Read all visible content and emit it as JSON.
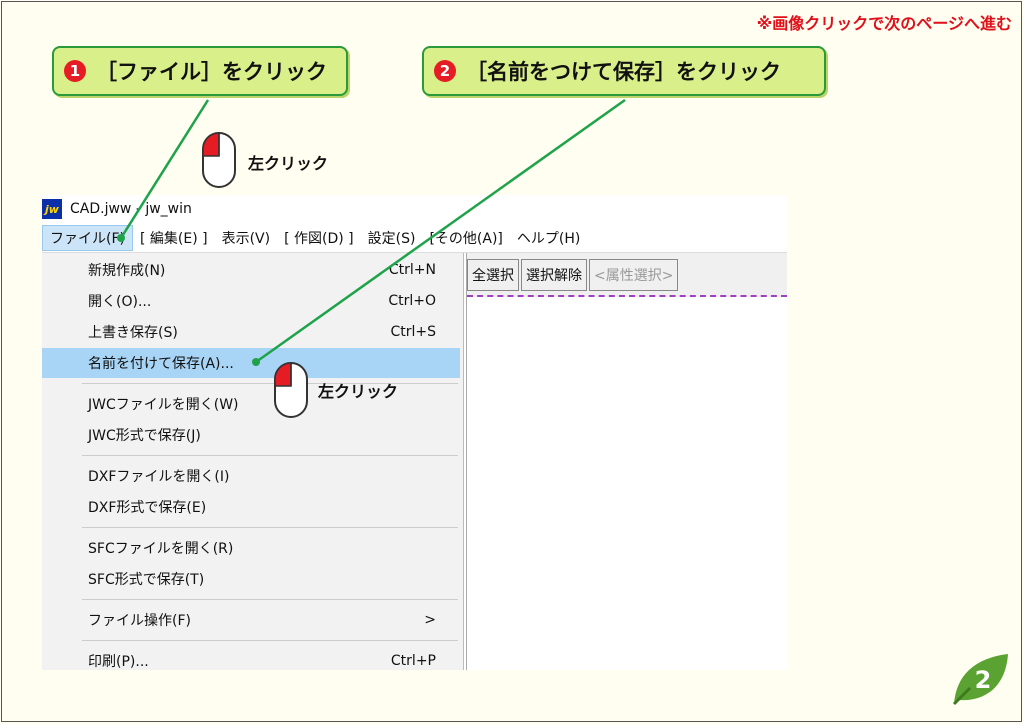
{
  "hint": "※画像クリックで次のページへ進む",
  "callouts": [
    {
      "num": "1",
      "text": "［ファイル］をクリック"
    },
    {
      "num": "2",
      "text": "［名前をつけて保存］をクリック"
    }
  ],
  "mouse_label": "左クリック",
  "window": {
    "logo": "jw",
    "title": "CAD.jww - jw_win"
  },
  "menubar": [
    "ファイル(F)",
    "[ 編集(E) ]",
    "表示(V)",
    "[ 作図(D) ]",
    "設定(S)",
    "[その他(A)]",
    "ヘルプ(H)"
  ],
  "file_menu": [
    {
      "label": "新規作成(N)",
      "shortcut": "Ctrl+N"
    },
    {
      "label": "開く(O)...",
      "shortcut": "Ctrl+O"
    },
    {
      "label": "上書き保存(S)",
      "shortcut": "Ctrl+S"
    },
    {
      "label": "名前を付けて保存(A)...",
      "shortcut": ""
    },
    {
      "label": "JWCファイルを開く(W)",
      "shortcut": ""
    },
    {
      "label": "JWC形式で保存(J)",
      "shortcut": ""
    },
    {
      "label": "DXFファイルを開く(I)",
      "shortcut": ""
    },
    {
      "label": "DXF形式で保存(E)",
      "shortcut": ""
    },
    {
      "label": "SFCファイルを開く(R)",
      "shortcut": ""
    },
    {
      "label": "SFC形式で保存(T)",
      "shortcut": ""
    },
    {
      "label": "ファイル操作(F)",
      "shortcut": ">"
    },
    {
      "label": "印刷(P)...",
      "shortcut": "Ctrl+P"
    }
  ],
  "toolbar": {
    "select_all": "全選択",
    "deselect": "選択解除",
    "attr_select": "<属性選択>"
  },
  "page_number": "2",
  "colors": {
    "callout_bg": "#d9f08a",
    "callout_border": "#2a9a3a",
    "hint_red": "#e0101a",
    "highlight": "#a8d4f5"
  }
}
